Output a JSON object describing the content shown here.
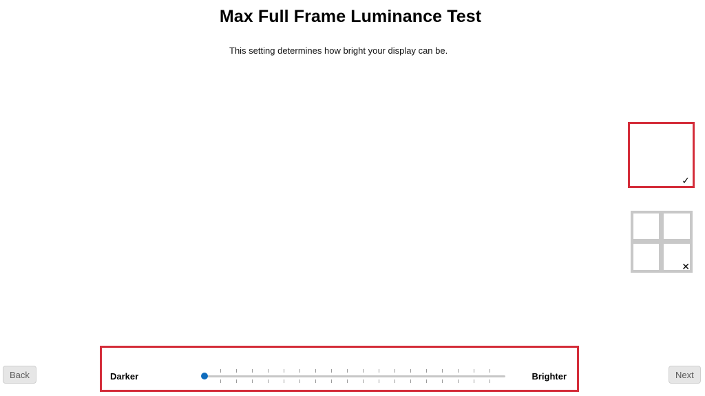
{
  "header": {
    "title": "Max Full Frame Luminance Test",
    "description": "This setting determines how bright your display can be."
  },
  "reference": {
    "correct": {
      "mark": "✓",
      "icon": "checkmark-icon"
    },
    "incorrect": {
      "mark": "✕",
      "icon": "x-icon"
    },
    "colors": {
      "highlight": "#d42d3a",
      "grid": "#c8c8c8"
    }
  },
  "slider": {
    "min_label": "Darker",
    "max_label": "Brighter",
    "value_fraction": 0.0,
    "tick_count": 18,
    "thumb_color": "#0f6cbd",
    "track_color": "#c7c7c7"
  },
  "nav": {
    "back_label": "Back",
    "next_label": "Next"
  }
}
